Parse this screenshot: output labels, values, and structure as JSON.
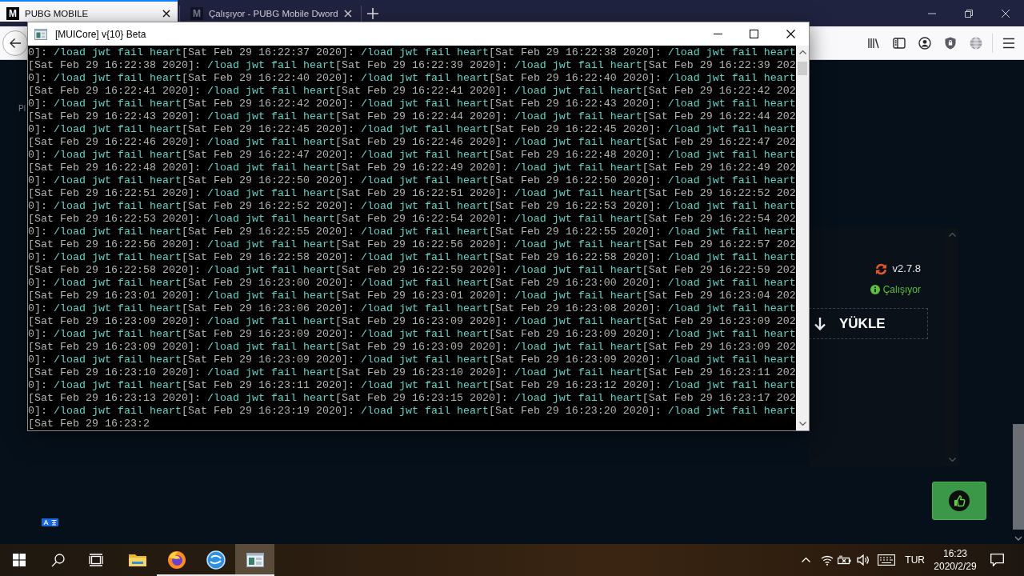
{
  "browser": {
    "tabs": [
      {
        "logo": "M",
        "title": "PUBG MOBILE",
        "selected": true
      },
      {
        "logo": "M",
        "title": "Çalışıyor - PUBG Mobile Dword",
        "selected": false
      }
    ]
  },
  "page": {
    "side_label": "Pl",
    "panel": {
      "version": "v2.7.8",
      "status": "Çalışıyor",
      "install_button": "YÜKLE"
    }
  },
  "console_window": {
    "title": "[MUICore] v{10} Beta",
    "lines": [
      [
        {
          "kind": "stamp",
          "text": "0]: "
        },
        {
          "kind": "message",
          "text": "/load jwt fail heart"
        },
        {
          "kind": "stamp",
          "text": "[Sat Feb 29 16:22:37 2020]: "
        },
        {
          "kind": "message",
          "text": "/load jwt fail heart"
        },
        {
          "kind": "stamp",
          "text": "[Sat Feb 29 16:22:38 2020]: "
        },
        {
          "kind": "message",
          "text": "/load jwt fail heart"
        }
      ],
      [
        {
          "kind": "stamp",
          "text": "[Sat Feb 29 16:22:38 2020]: "
        },
        {
          "kind": "message",
          "text": "/load jwt fail heart"
        },
        {
          "kind": "stamp",
          "text": "[Sat Feb 29 16:22:39 2020]: "
        },
        {
          "kind": "message",
          "text": "/load jwt fail heart"
        },
        {
          "kind": "stamp",
          "text": "[Sat Feb 29 16:22:39 202"
        }
      ],
      [
        {
          "kind": "stamp",
          "text": "0]: "
        },
        {
          "kind": "message",
          "text": "/load jwt fail heart"
        },
        {
          "kind": "stamp",
          "text": "[Sat Feb 29 16:22:40 2020]: "
        },
        {
          "kind": "message",
          "text": "/load jwt fail heart"
        },
        {
          "kind": "stamp",
          "text": "[Sat Feb 29 16:22:40 2020]: "
        },
        {
          "kind": "message",
          "text": "/load jwt fail heart"
        }
      ],
      [
        {
          "kind": "stamp",
          "text": "[Sat Feb 29 16:22:41 2020]: "
        },
        {
          "kind": "message",
          "text": "/load jwt fail heart"
        },
        {
          "kind": "stamp",
          "text": "[Sat Feb 29 16:22:41 2020]: "
        },
        {
          "kind": "message",
          "text": "/load jwt fail heart"
        },
        {
          "kind": "stamp",
          "text": "[Sat Feb 29 16:22:42 202"
        }
      ],
      [
        {
          "kind": "stamp",
          "text": "0]: "
        },
        {
          "kind": "message",
          "text": "/load jwt fail heart"
        },
        {
          "kind": "stamp",
          "text": "[Sat Feb 29 16:22:42 2020]: "
        },
        {
          "kind": "message",
          "text": "/load jwt fail heart"
        },
        {
          "kind": "stamp",
          "text": "[Sat Feb 29 16:22:43 2020]: "
        },
        {
          "kind": "message",
          "text": "/load jwt fail heart"
        }
      ],
      [
        {
          "kind": "stamp",
          "text": "[Sat Feb 29 16:22:43 2020]: "
        },
        {
          "kind": "message",
          "text": "/load jwt fail heart"
        },
        {
          "kind": "stamp",
          "text": "[Sat Feb 29 16:22:44 2020]: "
        },
        {
          "kind": "message",
          "text": "/load jwt fail heart"
        },
        {
          "kind": "stamp",
          "text": "[Sat Feb 29 16:22:44 202"
        }
      ],
      [
        {
          "kind": "stamp",
          "text": "0]: "
        },
        {
          "kind": "message",
          "text": "/load jwt fail heart"
        },
        {
          "kind": "stamp",
          "text": "[Sat Feb 29 16:22:45 2020]: "
        },
        {
          "kind": "message",
          "text": "/load jwt fail heart"
        },
        {
          "kind": "stamp",
          "text": "[Sat Feb 29 16:22:45 2020]: "
        },
        {
          "kind": "message",
          "text": "/load jwt fail heart"
        }
      ],
      [
        {
          "kind": "stamp",
          "text": "[Sat Feb 29 16:22:46 2020]: "
        },
        {
          "kind": "message",
          "text": "/load jwt fail heart"
        },
        {
          "kind": "stamp",
          "text": "[Sat Feb 29 16:22:46 2020]: "
        },
        {
          "kind": "message",
          "text": "/load jwt fail heart"
        },
        {
          "kind": "stamp",
          "text": "[Sat Feb 29 16:22:47 202"
        }
      ],
      [
        {
          "kind": "stamp",
          "text": "0]: "
        },
        {
          "kind": "message",
          "text": "/load jwt fail heart"
        },
        {
          "kind": "stamp",
          "text": "[Sat Feb 29 16:22:47 2020]: "
        },
        {
          "kind": "message",
          "text": "/load jwt fail heart"
        },
        {
          "kind": "stamp",
          "text": "[Sat Feb 29 16:22:48 2020]: "
        },
        {
          "kind": "message",
          "text": "/load jwt fail heart"
        }
      ],
      [
        {
          "kind": "stamp",
          "text": "[Sat Feb 29 16:22:48 2020]: "
        },
        {
          "kind": "message",
          "text": "/load jwt fail heart"
        },
        {
          "kind": "stamp",
          "text": "[Sat Feb 29 16:22:49 2020]: "
        },
        {
          "kind": "message",
          "text": "/load jwt fail heart"
        },
        {
          "kind": "stamp",
          "text": "[Sat Feb 29 16:22:49 202"
        }
      ],
      [
        {
          "kind": "stamp",
          "text": "0]: "
        },
        {
          "kind": "message",
          "text": "/load jwt fail heart"
        },
        {
          "kind": "stamp",
          "text": "[Sat Feb 29 16:22:50 2020]: "
        },
        {
          "kind": "message",
          "text": "/load jwt fail heart"
        },
        {
          "kind": "stamp",
          "text": "[Sat Feb 29 16:22:50 2020]: "
        },
        {
          "kind": "message",
          "text": "/load jwt fail heart"
        }
      ],
      [
        {
          "kind": "stamp",
          "text": "[Sat Feb 29 16:22:51 2020]: "
        },
        {
          "kind": "message",
          "text": "/load jwt fail heart"
        },
        {
          "kind": "stamp",
          "text": "[Sat Feb 29 16:22:51 2020]: "
        },
        {
          "kind": "message",
          "text": "/load jwt fail heart"
        },
        {
          "kind": "stamp",
          "text": "[Sat Feb 29 16:22:52 202"
        }
      ],
      [
        {
          "kind": "stamp",
          "text": "0]: "
        },
        {
          "kind": "message",
          "text": "/load jwt fail heart"
        },
        {
          "kind": "stamp",
          "text": "[Sat Feb 29 16:22:52 2020]: "
        },
        {
          "kind": "message",
          "text": "/load jwt fail heart"
        },
        {
          "kind": "stamp",
          "text": "[Sat Feb 29 16:22:53 2020]: "
        },
        {
          "kind": "message",
          "text": "/load jwt fail heart"
        }
      ],
      [
        {
          "kind": "stamp",
          "text": "[Sat Feb 29 16:22:53 2020]: "
        },
        {
          "kind": "message",
          "text": "/load jwt fail heart"
        },
        {
          "kind": "stamp",
          "text": "[Sat Feb 29 16:22:54 2020]: "
        },
        {
          "kind": "message",
          "text": "/load jwt fail heart"
        },
        {
          "kind": "stamp",
          "text": "[Sat Feb 29 16:22:54 202"
        }
      ],
      [
        {
          "kind": "stamp",
          "text": "0]: "
        },
        {
          "kind": "message",
          "text": "/load jwt fail heart"
        },
        {
          "kind": "stamp",
          "text": "[Sat Feb 29 16:22:55 2020]: "
        },
        {
          "kind": "message",
          "text": "/load jwt fail heart"
        },
        {
          "kind": "stamp",
          "text": "[Sat Feb 29 16:22:55 2020]: "
        },
        {
          "kind": "message",
          "text": "/load jwt fail heart"
        }
      ],
      [
        {
          "kind": "stamp",
          "text": "[Sat Feb 29 16:22:56 2020]: "
        },
        {
          "kind": "message",
          "text": "/load jwt fail heart"
        },
        {
          "kind": "stamp",
          "text": "[Sat Feb 29 16:22:56 2020]: "
        },
        {
          "kind": "message",
          "text": "/load jwt fail heart"
        },
        {
          "kind": "stamp",
          "text": "[Sat Feb 29 16:22:57 202"
        }
      ],
      [
        {
          "kind": "stamp",
          "text": "0]: "
        },
        {
          "kind": "message",
          "text": "/load jwt fail heart"
        },
        {
          "kind": "stamp",
          "text": "[Sat Feb 29 16:22:58 2020]: "
        },
        {
          "kind": "message",
          "text": "/load jwt fail heart"
        },
        {
          "kind": "stamp",
          "text": "[Sat Feb 29 16:22:58 2020]: "
        },
        {
          "kind": "message",
          "text": "/load jwt fail heart"
        }
      ],
      [
        {
          "kind": "stamp",
          "text": "[Sat Feb 29 16:22:58 2020]: "
        },
        {
          "kind": "message",
          "text": "/load jwt fail heart"
        },
        {
          "kind": "stamp",
          "text": "[Sat Feb 29 16:22:59 2020]: "
        },
        {
          "kind": "message",
          "text": "/load jwt fail heart"
        },
        {
          "kind": "stamp",
          "text": "[Sat Feb 29 16:22:59 202"
        }
      ],
      [
        {
          "kind": "stamp",
          "text": "0]: "
        },
        {
          "kind": "message",
          "text": "/load jwt fail heart"
        },
        {
          "kind": "stamp",
          "text": "[Sat Feb 29 16:23:00 2020]: "
        },
        {
          "kind": "message",
          "text": "/load jwt fail heart"
        },
        {
          "kind": "stamp",
          "text": "[Sat Feb 29 16:23:00 2020]: "
        },
        {
          "kind": "message",
          "text": "/load jwt fail heart"
        }
      ],
      [
        {
          "kind": "stamp",
          "text": "[Sat Feb 29 16:23:01 2020]: "
        },
        {
          "kind": "message",
          "text": "/load jwt fail heart"
        },
        {
          "kind": "stamp",
          "text": "[Sat Feb 29 16:23:01 2020]: "
        },
        {
          "kind": "message",
          "text": "/load jwt fail heart"
        },
        {
          "kind": "stamp",
          "text": "[Sat Feb 29 16:23:04 202"
        }
      ],
      [
        {
          "kind": "stamp",
          "text": "0]: "
        },
        {
          "kind": "message",
          "text": "/load jwt fail heart"
        },
        {
          "kind": "stamp",
          "text": "[Sat Feb 29 16:23:06 2020]: "
        },
        {
          "kind": "message",
          "text": "/load jwt fail heart"
        },
        {
          "kind": "stamp",
          "text": "[Sat Feb 29 16:23:08 2020]: "
        },
        {
          "kind": "message",
          "text": "/load jwt fail heart"
        }
      ],
      [
        {
          "kind": "stamp",
          "text": "[Sat Feb 29 16:23:09 2020]: "
        },
        {
          "kind": "message",
          "text": "/load jwt fail heart"
        },
        {
          "kind": "stamp",
          "text": "[Sat Feb 29 16:23:09 2020]: "
        },
        {
          "kind": "message",
          "text": "/load jwt fail heart"
        },
        {
          "kind": "stamp",
          "text": "[Sat Feb 29 16:23:09 202"
        }
      ],
      [
        {
          "kind": "stamp",
          "text": "0]: "
        },
        {
          "kind": "message",
          "text": "/load jwt fail heart"
        },
        {
          "kind": "stamp",
          "text": "[Sat Feb 29 16:23:09 2020]: "
        },
        {
          "kind": "message",
          "text": "/load jwt fail heart"
        },
        {
          "kind": "stamp",
          "text": "[Sat Feb 29 16:23:09 2020]: "
        },
        {
          "kind": "message",
          "text": "/load jwt fail heart"
        }
      ],
      [
        {
          "kind": "stamp",
          "text": "[Sat Feb 29 16:23:09 2020]: "
        },
        {
          "kind": "message",
          "text": "/load jwt fail heart"
        },
        {
          "kind": "stamp",
          "text": "[Sat Feb 29 16:23:09 2020]: "
        },
        {
          "kind": "message",
          "text": "/load jwt fail heart"
        },
        {
          "kind": "stamp",
          "text": "[Sat Feb 29 16:23:09 202"
        }
      ],
      [
        {
          "kind": "stamp",
          "text": "0]: "
        },
        {
          "kind": "message",
          "text": "/load jwt fail heart"
        },
        {
          "kind": "stamp",
          "text": "[Sat Feb 29 16:23:09 2020]: "
        },
        {
          "kind": "message",
          "text": "/load jwt fail heart"
        },
        {
          "kind": "stamp",
          "text": "[Sat Feb 29 16:23:09 2020]: "
        },
        {
          "kind": "message",
          "text": "/load jwt fail heart"
        }
      ],
      [
        {
          "kind": "stamp",
          "text": "[Sat Feb 29 16:23:10 2020]: "
        },
        {
          "kind": "message",
          "text": "/load jwt fail heart"
        },
        {
          "kind": "stamp",
          "text": "[Sat Feb 29 16:23:10 2020]: "
        },
        {
          "kind": "message",
          "text": "/load jwt fail heart"
        },
        {
          "kind": "stamp",
          "text": "[Sat Feb 29 16:23:11 202"
        }
      ],
      [
        {
          "kind": "stamp",
          "text": "0]: "
        },
        {
          "kind": "message",
          "text": "/load jwt fail heart"
        },
        {
          "kind": "stamp",
          "text": "[Sat Feb 29 16:23:11 2020]: "
        },
        {
          "kind": "message",
          "text": "/load jwt fail heart"
        },
        {
          "kind": "stamp",
          "text": "[Sat Feb 29 16:23:12 2020]: "
        },
        {
          "kind": "message",
          "text": "/load jwt fail heart"
        }
      ],
      [
        {
          "kind": "stamp",
          "text": "[Sat Feb 29 16:23:13 2020]: "
        },
        {
          "kind": "message",
          "text": "/load jwt fail heart"
        },
        {
          "kind": "stamp",
          "text": "[Sat Feb 29 16:23:15 2020]: "
        },
        {
          "kind": "message",
          "text": "/load jwt fail heart"
        },
        {
          "kind": "stamp",
          "text": "[Sat Feb 29 16:23:17 202"
        }
      ],
      [
        {
          "kind": "stamp",
          "text": "0]: "
        },
        {
          "kind": "message",
          "text": "/load jwt fail heart"
        },
        {
          "kind": "stamp",
          "text": "[Sat Feb 29 16:23:19 2020]: "
        },
        {
          "kind": "message",
          "text": "/load jwt fail heart"
        },
        {
          "kind": "stamp",
          "text": "[Sat Feb 29 16:23:20 2020]: "
        },
        {
          "kind": "message",
          "text": "/load jwt fail heart"
        }
      ],
      [
        {
          "kind": "stamp",
          "text": "[Sat Feb 29 16:23:2"
        }
      ]
    ]
  },
  "taskbar": {
    "apps": [
      {
        "kind": "folder",
        "open": false,
        "selected": false
      },
      {
        "kind": "fox",
        "open": true,
        "selected": false
      },
      {
        "kind": "sphere",
        "open": true,
        "selected": false
      },
      {
        "kind": "console",
        "open": true,
        "selected": true
      }
    ],
    "language": "TUR",
    "time": "16:23",
    "date": "2020/2/29"
  }
}
